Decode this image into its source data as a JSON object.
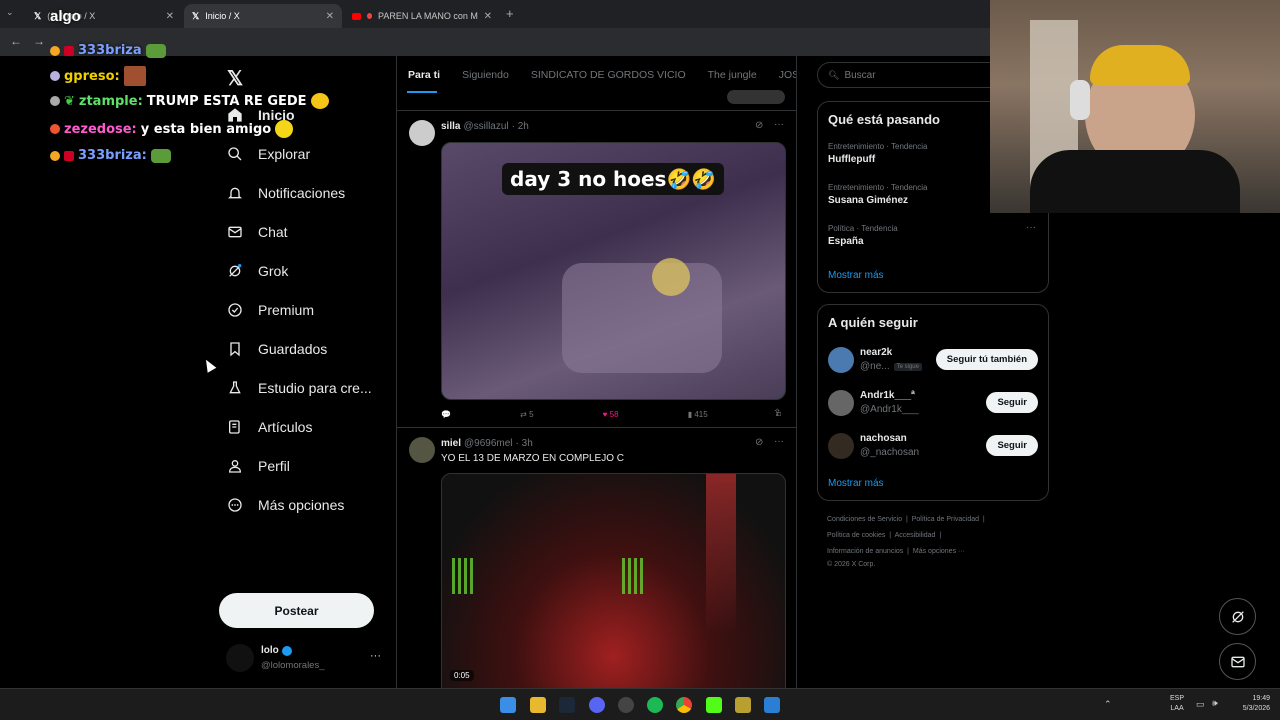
{
  "browser": {
    "tabs": [
      {
        "label": "(2) Inicio / X"
      },
      {
        "label": "Inicio / X"
      },
      {
        "label": "PAREN LA MANO con MA..."
      }
    ],
    "overlay_text": "algo"
  },
  "chat_overlay": [
    {
      "user": "333briza",
      "msg": ""
    },
    {
      "user": "gpreso:",
      "msg": ""
    },
    {
      "user": "ztample:",
      "msg": "TRUMP ESTA RE GEDE"
    },
    {
      "user": "zezedose:",
      "msg": "y esta bien amigo"
    },
    {
      "user": "333briza:",
      "msg": ""
    }
  ],
  "nav": {
    "items": [
      {
        "label": "Inicio",
        "icon": "home-icon"
      },
      {
        "label": "Explorar",
        "icon": "search-icon"
      },
      {
        "label": "Notificaciones",
        "icon": "bell-icon"
      },
      {
        "label": "Chat",
        "icon": "mail-icon"
      },
      {
        "label": "Grok",
        "icon": "grok-icon"
      },
      {
        "label": "Premium",
        "icon": "verified-icon"
      },
      {
        "label": "Guardados",
        "icon": "bookmark-icon"
      },
      {
        "label": "Estudio para cre...",
        "icon": "flask-icon"
      },
      {
        "label": "Artículos",
        "icon": "article-icon"
      },
      {
        "label": "Perfil",
        "icon": "person-icon"
      },
      {
        "label": "Más opciones",
        "icon": "more-icon"
      }
    ],
    "post_button": "Postear",
    "account": {
      "name": "lolo",
      "handle": "@lolomorales_"
    }
  },
  "feed": {
    "tabs": [
      "Para ti",
      "Siguiendo",
      "SINDICATO DE GORDOS VICIO",
      "The jungle",
      "JOSEO"
    ],
    "tweets": [
      {
        "name": "silla",
        "handle": "@ssillazul",
        "time": "· 2h",
        "text": "",
        "media_caption": "day 3 no hoes🤣🤣",
        "replies": "",
        "retweets": "5",
        "likes": "58",
        "views": "415"
      },
      {
        "name": "miel",
        "handle": "@9696mel",
        "time": "· 3h",
        "text": "YO EL 13 DE MARZO EN COMPLEJO C",
        "video_time": "0:05"
      }
    ]
  },
  "right": {
    "search_placeholder": "Buscar",
    "trends_title": "Qué está pasando",
    "trends": [
      {
        "category": "Entretenimiento · Tendencia",
        "name": "Hufflepuff"
      },
      {
        "category": "Entretenimiento · Tendencia",
        "name": "Susana Giménez"
      },
      {
        "category": "Política · Tendencia",
        "name": "España"
      }
    ],
    "show_more": "Mostrar más",
    "who_title": "A quién seguir",
    "who": [
      {
        "name": "near2k",
        "handle": "@ne...",
        "badge": "Te sigue",
        "button": "Seguir tú también"
      },
      {
        "name": "Andr1k___ª",
        "handle": "@Andr1k___",
        "badge": "",
        "button": "Seguir"
      },
      {
        "name": "nachosan",
        "handle": "@_nachosan",
        "badge": "",
        "button": "Seguir"
      }
    ],
    "show_more2": "Mostrar más",
    "footer": {
      "l1a": "Condiciones de Servicio",
      "l1b": "Política de Privacidad",
      "l2a": "Política de cookies",
      "l2b": "Accesibilidad",
      "l3a": "Información de anuncios",
      "l3b": "Más opciones ···",
      "copyright": "© 2026 X Corp."
    }
  },
  "taskbar": {
    "lang1": "ESP",
    "lang2": "LAA",
    "time": "19:49",
    "date": "5/3/2026"
  }
}
